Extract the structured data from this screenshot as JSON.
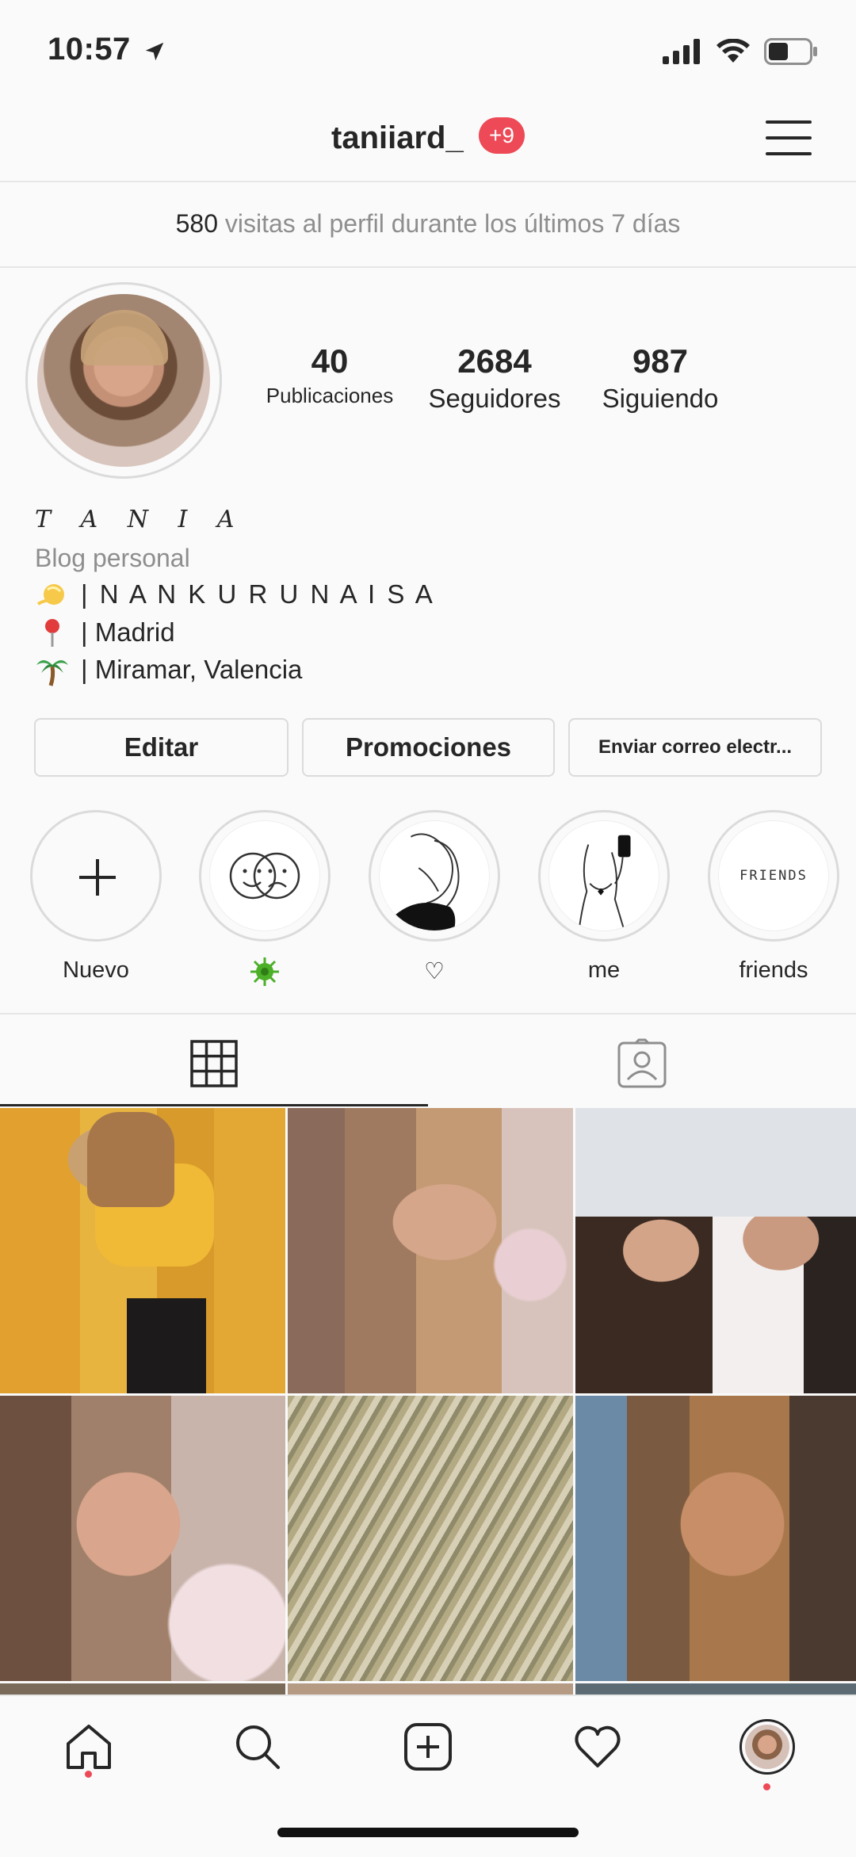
{
  "status_bar": {
    "time": "10:57"
  },
  "header": {
    "username": "taniiard_",
    "notification_badge": "+9"
  },
  "visits": {
    "count": "580",
    "text": "visitas al perfil durante los últimos 7 días"
  },
  "profile": {
    "stats": [
      {
        "value": "40",
        "label": "Publicaciones"
      },
      {
        "value": "2684",
        "label": "Seguidores"
      },
      {
        "value": "987",
        "label": "Siguiendo"
      }
    ],
    "name": "T A N I A",
    "category": "Blog personal",
    "bio": [
      {
        "icon": "sparkle-emoji-icon",
        "text": "| N A N K U R U N A I S A"
      },
      {
        "icon": "pin-emoji-icon",
        "text": "| Madrid"
      },
      {
        "icon": "palm-tree-emoji-icon",
        "text": "| Miramar, Valencia"
      }
    ]
  },
  "buttons": {
    "edit": "Editar",
    "promotions": "Promociones",
    "email": "Enviar correo electr..."
  },
  "highlights": [
    {
      "label": "Nuevo"
    },
    {
      "label": ""
    },
    {
      "label": "♡"
    },
    {
      "label": "me"
    },
    {
      "label": "friends",
      "cover_text": "FRIENDS"
    }
  ],
  "tabs": [
    {
      "icon": "grid-icon",
      "active": true
    },
    {
      "icon": "tagged-icon",
      "active": false
    }
  ],
  "colors": {
    "accent": "#ed4956",
    "border": "#dbdbdb",
    "muted": "#8e8e8e"
  }
}
